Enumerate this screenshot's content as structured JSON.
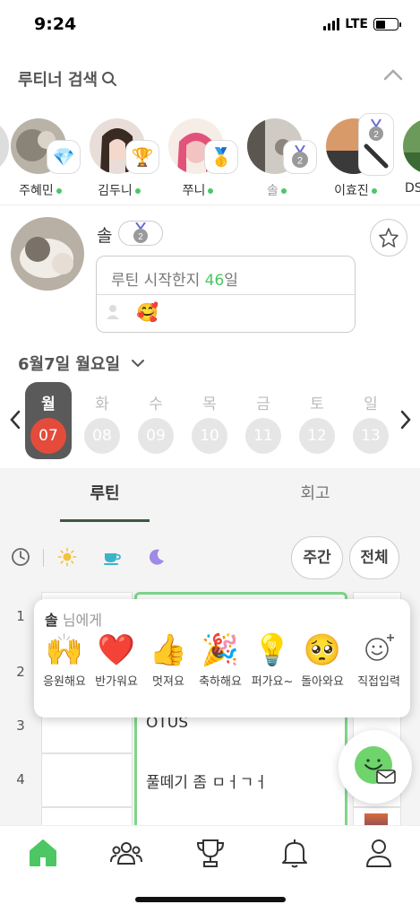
{
  "status_bar": {
    "time": "9:24",
    "network": "LTE"
  },
  "search": {
    "title": "루티너 검색"
  },
  "friends": [
    {
      "name": "",
      "badge": ""
    },
    {
      "name": "주혜민",
      "badge": "💎",
      "online": true
    },
    {
      "name": "김두니",
      "badge": "🏆",
      "online": true
    },
    {
      "name": "쭈니",
      "badge": "🥇",
      "online": true
    },
    {
      "name": "솔",
      "badge": "2",
      "online": true
    },
    {
      "name": "이효진",
      "badge": "2",
      "online": true
    },
    {
      "name": "DS",
      "badge": ""
    }
  ],
  "profile": {
    "name": "솔",
    "medal_number": "2",
    "days_prefix": "루틴 시작한지 ",
    "days": "46",
    "days_suffix": "일",
    "reaction_emoji": "🥰"
  },
  "date": {
    "label": "6월7일 월요일"
  },
  "week": [
    {
      "day": "월",
      "num": "07",
      "selected": true
    },
    {
      "day": "화",
      "num": "08"
    },
    {
      "day": "수",
      "num": "09"
    },
    {
      "day": "목",
      "num": "10"
    },
    {
      "day": "금",
      "num": "11"
    },
    {
      "day": "토",
      "num": "12"
    },
    {
      "day": "일",
      "num": "13"
    }
  ],
  "tabs": {
    "routine": "루틴",
    "review": "회고"
  },
  "filters": {
    "weekly": "주간",
    "all": "전체"
  },
  "grid": {
    "rows": [
      {
        "num": "1",
        "text": ""
      },
      {
        "num": "2",
        "text": ""
      },
      {
        "num": "3",
        "text": "OTUS"
      },
      {
        "num": "4",
        "text": "풀떼기 좀 ㅁㅓㄱㅓ"
      }
    ]
  },
  "reaction_popup": {
    "name": "솔",
    "suffix": " 님에게",
    "items": [
      {
        "emoji": "🙌",
        "label": "응원해요"
      },
      {
        "emoji": "❤️",
        "label": "반가워요"
      },
      {
        "emoji": "👍",
        "label": "멋져요"
      },
      {
        "emoji": "🎉",
        "label": "축하해요"
      },
      {
        "emoji": "💡",
        "label": "퍼가요~"
      },
      {
        "emoji": "🥺",
        "label": "돌아와요"
      },
      {
        "emoji": "",
        "label": "직접입력"
      }
    ]
  },
  "colors": {
    "accent": "#4cc764",
    "selected_day": "#e44b3b",
    "tab_underline": "#3c5a3c",
    "routine_border": "#7ed68a"
  }
}
